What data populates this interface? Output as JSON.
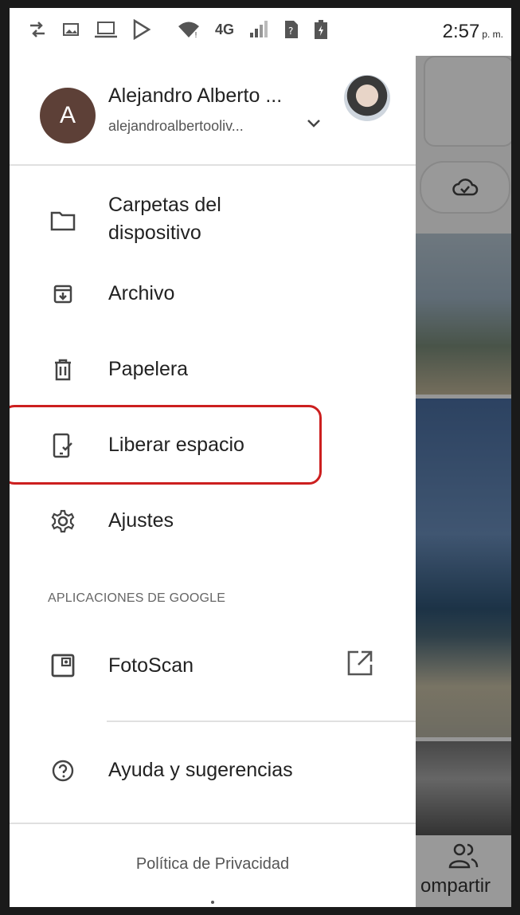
{
  "status_bar": {
    "network": "4G",
    "time": "2:57",
    "time_suffix": "p. m."
  },
  "account": {
    "avatar_initial": "A",
    "name": "Alejandro Alberto ...",
    "email": "alejandroalbertooliv..."
  },
  "menu": {
    "items": [
      {
        "label": "Carpetas del dispositivo",
        "icon": "folder-icon"
      },
      {
        "label": "Archivo",
        "icon": "archive-icon"
      },
      {
        "label": "Papelera",
        "icon": "trash-icon"
      },
      {
        "label": "Liberar espacio",
        "icon": "free-up-space-icon"
      },
      {
        "label": "Ajustes",
        "icon": "gear-icon"
      }
    ],
    "google_apps_header": "APLICACIONES DE GOOGLE",
    "google_apps": [
      {
        "label": "FotoScan",
        "icon": "photoscan-icon"
      }
    ],
    "help": {
      "label": "Ayuda y sugerencias",
      "icon": "help-icon"
    }
  },
  "footer": {
    "privacy_link": "Política de Privacidad"
  },
  "background": {
    "share_label": "ompartir"
  },
  "colors": {
    "avatar_bg": "#5d4037",
    "highlight": "#cc1f1f",
    "text_primary": "#222222"
  }
}
